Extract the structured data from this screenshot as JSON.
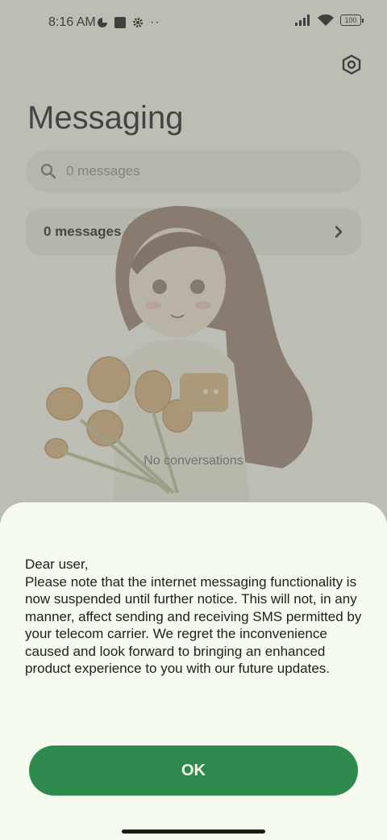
{
  "status_bar": {
    "time": "8:16 AM",
    "battery": "100",
    "icons": [
      "data-saver-icon",
      "square-icon",
      "gear-icon",
      "more-dots-icon",
      "signal-icon",
      "wifi-icon",
      "battery-icon"
    ]
  },
  "header": {
    "title": "Messaging",
    "settings_icon": "settings-hexagon-icon"
  },
  "search": {
    "placeholder": "0 messages",
    "icon": "search-icon"
  },
  "messages_card": {
    "label": "0 messages",
    "icon": "chevron-right-icon"
  },
  "empty_state": {
    "label": "No conversations"
  },
  "dialog": {
    "message": "Dear user,\nPlease note that the internet messaging functionality is now suspended until further notice. This will not, in any manner, affect sending and receiving SMS permitted by your telecom carrier. We regret the inconvenience caused and look forward to bringing an enhanced product experience to you with our future updates.",
    "ok_label": "OK",
    "accent": "#2e8b4d"
  }
}
